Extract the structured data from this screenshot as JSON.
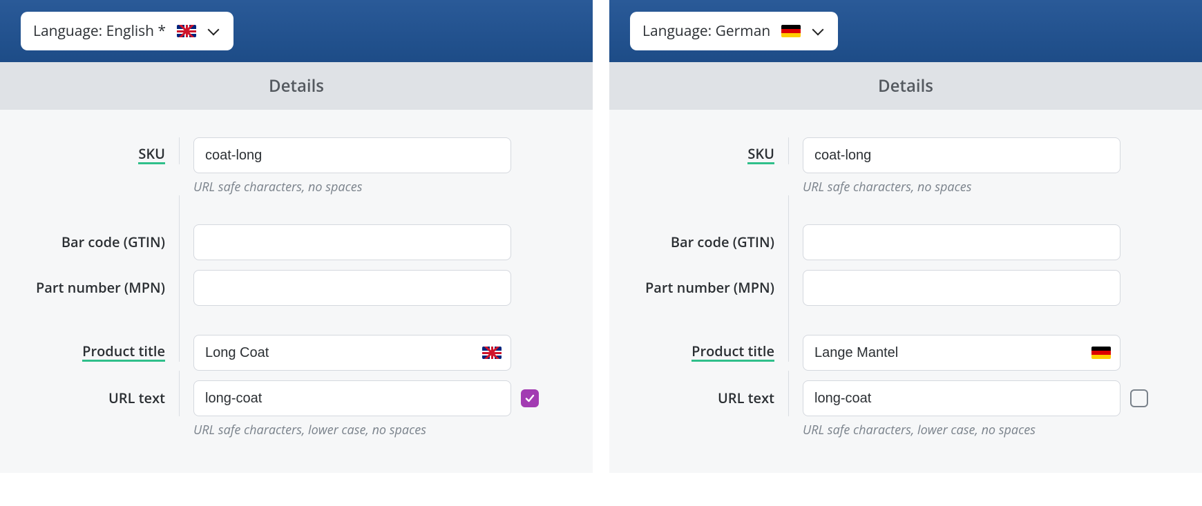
{
  "left": {
    "language_label": "Language: English *",
    "flag": "uk",
    "section_title": "Details",
    "fields": {
      "sku_label": "SKU",
      "sku_value": "coat-long",
      "sku_help": "URL safe characters, no spaces",
      "barcode_label": "Bar code (GTIN)",
      "barcode_value": "",
      "mpn_label": "Part number (MPN)",
      "mpn_value": "",
      "title_label": "Product title",
      "title_value": "Long Coat",
      "urltext_label": "URL text",
      "urltext_value": "long-coat",
      "urltext_help": "URL safe characters, lower case, no spaces",
      "urltext_checked": true
    }
  },
  "right": {
    "language_label": "Language: German",
    "flag": "de",
    "section_title": "Details",
    "fields": {
      "sku_label": "SKU",
      "sku_value": "coat-long",
      "sku_help": "URL safe characters, no spaces",
      "barcode_label": "Bar code (GTIN)",
      "barcode_value": "",
      "mpn_label": "Part number (MPN)",
      "mpn_value": "",
      "title_label": "Product title",
      "title_value": "Lange Mantel",
      "urltext_label": "URL text",
      "urltext_value": "long-coat",
      "urltext_help": "URL safe characters, lower case, no spaces",
      "urltext_checked": false
    }
  }
}
